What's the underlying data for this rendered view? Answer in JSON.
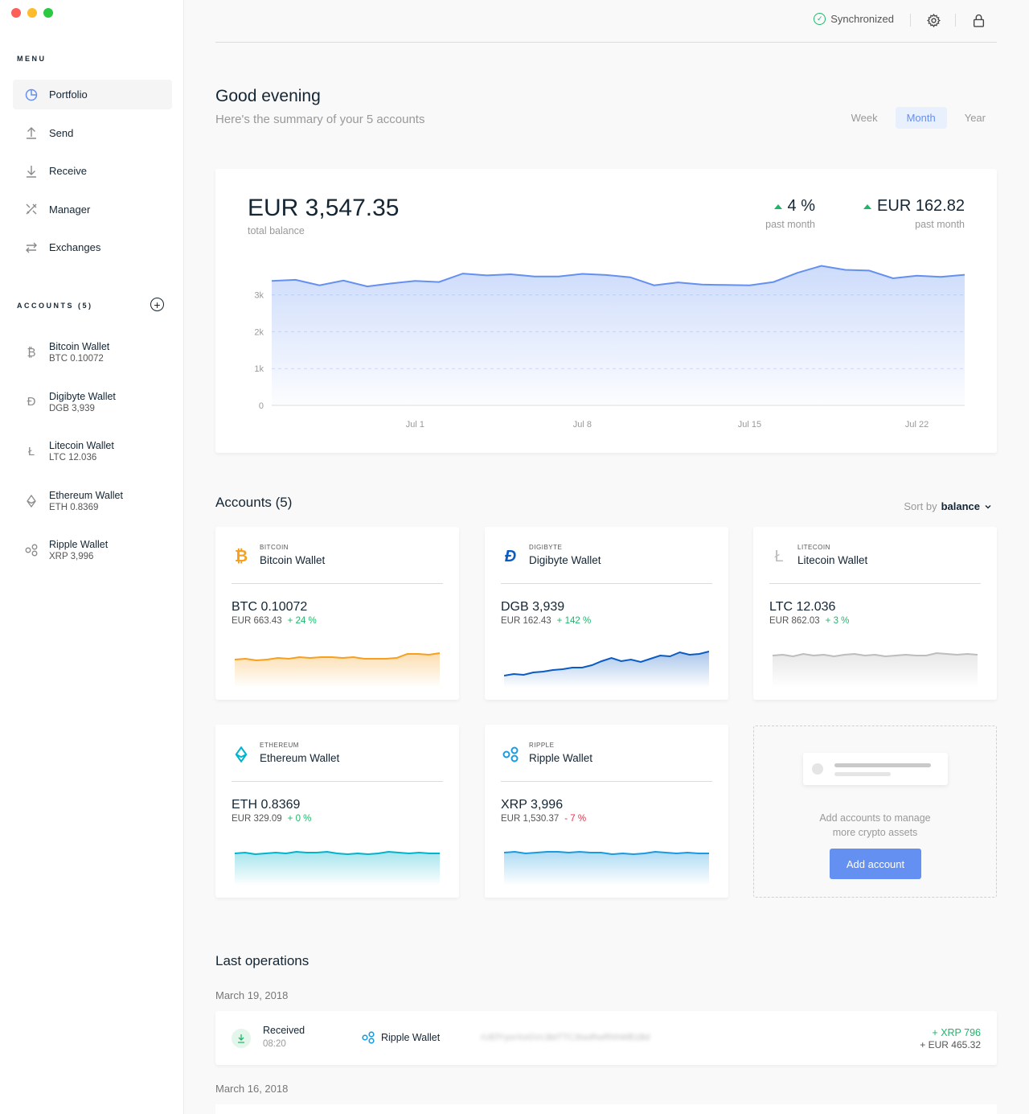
{
  "sidebar": {
    "menu_title": "MENU",
    "menu": [
      {
        "label": "Portfolio",
        "icon": "pie-chart-icon",
        "active": true
      },
      {
        "label": "Send",
        "icon": "upload-arrow-icon"
      },
      {
        "label": "Receive",
        "icon": "download-arrow-icon"
      },
      {
        "label": "Manager",
        "icon": "tools-icon"
      },
      {
        "label": "Exchanges",
        "icon": "swap-arrows-icon"
      }
    ],
    "accounts_title": "ACCOUNTS (5)",
    "accounts": [
      {
        "name": "Bitcoin Wallet",
        "balance": "BTC 0.10072",
        "icon": "bitcoin-icon"
      },
      {
        "name": "Digibyte Wallet",
        "balance": "DGB 3,939",
        "icon": "digibyte-icon"
      },
      {
        "name": "Litecoin Wallet",
        "balance": "LTC 12.036",
        "icon": "litecoin-icon"
      },
      {
        "name": "Ethereum Wallet",
        "balance": "ETH 0.8369",
        "icon": "ethereum-icon"
      },
      {
        "name": "Ripple Wallet",
        "balance": "XRP 3,996",
        "icon": "ripple-icon"
      }
    ]
  },
  "topbar": {
    "sync_label": "Synchronized",
    "settings_icon": "gear-icon",
    "lock_icon": "lock-icon"
  },
  "header": {
    "greeting": "Good evening",
    "summary": "Here's the summary of your 5 accounts",
    "periods": [
      "Week",
      "Month",
      "Year"
    ],
    "active_period": "Month"
  },
  "balance": {
    "total": "EUR 3,547.35",
    "total_label": "total balance",
    "pct_change": "4 %",
    "pct_label": "past month",
    "eur_change": "EUR 162.82",
    "eur_label": "past month"
  },
  "chart_data": {
    "type": "area",
    "title": "",
    "xlabel": "",
    "ylabel": "",
    "x_ticks": [
      "Jul 1",
      "Jul 8",
      "Jul 15",
      "Jul 22"
    ],
    "y_ticks": [
      "0",
      "1k",
      "2k",
      "3k"
    ],
    "ylim": [
      0,
      3800
    ],
    "grid": true,
    "values": [
      3380,
      3410,
      3260,
      3390,
      3230,
      3310,
      3380,
      3350,
      3580,
      3530,
      3560,
      3500,
      3500,
      3570,
      3540,
      3480,
      3260,
      3340,
      3280,
      3270,
      3260,
      3350,
      3600,
      3790,
      3680,
      3660,
      3450,
      3520,
      3490,
      3547
    ],
    "color": "#6490f1"
  },
  "accounts_section": {
    "title": "Accounts (5)",
    "sort_label": "Sort by",
    "sort_value": "balance",
    "cards": [
      {
        "currency": "BITCOIN",
        "name": "Bitcoin Wallet",
        "amount": "BTC 0.10072",
        "eur": "EUR 663.43",
        "change": "+ 24 %",
        "trend": "pos",
        "color": "#f7a01d",
        "icon": "bitcoin-icon",
        "spark": [
          40,
          41,
          39,
          40,
          42,
          41,
          43,
          42,
          43,
          43,
          42,
          43,
          41,
          41,
          41,
          42,
          47,
          47,
          46,
          48
        ]
      },
      {
        "currency": "DIGIBYTE",
        "name": "Digibyte Wallet",
        "amount": "DGB 3,939",
        "eur": "EUR 162.43",
        "change": "+ 142 %",
        "trend": "pos",
        "color": "#0a5bc4",
        "icon": "digibyte-icon",
        "spark": [
          20,
          22,
          21,
          24,
          25,
          27,
          28,
          30,
          30,
          33,
          38,
          42,
          38,
          40,
          37,
          41,
          45,
          44,
          49,
          46,
          47,
          50
        ]
      },
      {
        "currency": "LITECOIN",
        "name": "Litecoin Wallet",
        "amount": "LTC 12.036",
        "eur": "EUR 862.03",
        "change": "+ 3 %",
        "trend": "pos",
        "color": "#bdbdbd",
        "icon": "litecoin-icon",
        "spark": [
          45,
          46,
          44,
          47,
          45,
          46,
          44,
          46,
          47,
          45,
          46,
          44,
          45,
          46,
          45,
          45,
          48,
          47,
          46,
          47,
          46
        ]
      },
      {
        "currency": "ETHEREUM",
        "name": "Ethereum Wallet",
        "amount": "ETH 0.8369",
        "eur": "EUR 329.09",
        "change": "+ 0 %",
        "trend": "pos",
        "color": "#00b4cc",
        "icon": "ethereum-icon",
        "spark": [
          45,
          46,
          44,
          45,
          46,
          45,
          47,
          46,
          46,
          47,
          45,
          44,
          45,
          44,
          45,
          47,
          46,
          45,
          46,
          45,
          45
        ]
      },
      {
        "currency": "RIPPLE",
        "name": "Ripple Wallet",
        "amount": "XRP 3,996",
        "eur": "EUR 1,530.37",
        "change": "- 7 %",
        "trend": "neg",
        "color": "#1a9ae0",
        "icon": "ripple-icon",
        "spark": [
          46,
          47,
          45,
          46,
          47,
          47,
          46,
          47,
          46,
          46,
          44,
          45,
          44,
          45,
          47,
          46,
          45,
          46,
          45,
          45
        ]
      }
    ],
    "add_card": {
      "text_line1": "Add accounts to manage",
      "text_line2": "more crypto assets",
      "button": "Add account"
    }
  },
  "operations": {
    "title": "Last operations",
    "groups": [
      {
        "date": "March 19, 2018",
        "items": [
          {
            "type": "Received",
            "time": "08:20",
            "wallet": "Ripple Wallet",
            "address": "rUEfYyorXoGVc3btTTC3IsoRwRhhWB1Bd",
            "amount": "+ XRP 796",
            "eur": "+ EUR 465.32"
          }
        ]
      },
      {
        "date": "March 16, 2018",
        "items": []
      }
    ]
  }
}
